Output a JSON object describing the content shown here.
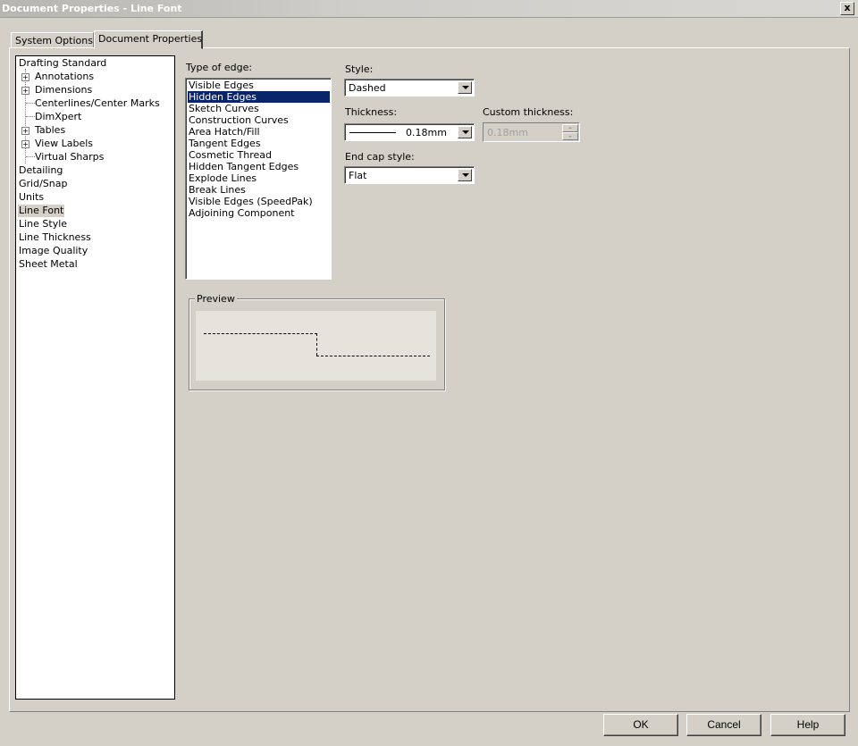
{
  "window": {
    "title": "Document Properties - Line Font",
    "close_label": "x"
  },
  "tabs": [
    {
      "label": "System Options",
      "active": false
    },
    {
      "label": "Document Properties",
      "active": true
    }
  ],
  "tree": {
    "items": [
      {
        "label": "Drafting Standard",
        "expander": ""
      },
      {
        "label": "Annotations",
        "expander": "+"
      },
      {
        "label": "Dimensions",
        "expander": "+"
      },
      {
        "label": "Centerlines/Center Marks",
        "expander": ""
      },
      {
        "label": "DimXpert",
        "expander": ""
      },
      {
        "label": "Tables",
        "expander": "+"
      },
      {
        "label": "View Labels",
        "expander": "+"
      },
      {
        "label": "Virtual Sharps",
        "expander": ""
      },
      {
        "label": "Detailing",
        "expander": ""
      },
      {
        "label": "Grid/Snap",
        "expander": ""
      },
      {
        "label": "Units",
        "expander": ""
      },
      {
        "label": "Line Font",
        "expander": "",
        "selected": true
      },
      {
        "label": "Line Style",
        "expander": ""
      },
      {
        "label": "Line Thickness",
        "expander": ""
      },
      {
        "label": "Image Quality",
        "expander": ""
      },
      {
        "label": "Sheet Metal",
        "expander": ""
      }
    ]
  },
  "edge_type": {
    "label": "Type of edge:",
    "selected": "Hidden Edges",
    "items": [
      "Visible Edges",
      "Hidden Edges",
      "Sketch Curves",
      "Construction Curves",
      "Area Hatch/Fill",
      "Tangent Edges",
      "Cosmetic Thread",
      "Hidden Tangent Edges",
      "Explode Lines",
      "Break Lines",
      "Visible Edges (SpeedPak)",
      "Adjoining Component"
    ]
  },
  "style": {
    "label": "Style:",
    "value": "Dashed"
  },
  "thickness": {
    "label": "Thickness:",
    "value": "0.18mm"
  },
  "custom_thickness": {
    "label": "Custom thickness:",
    "value": "0.18mm"
  },
  "end_cap": {
    "label": "End cap style:",
    "value": "Flat"
  },
  "preview": {
    "label": "Preview"
  },
  "buttons": {
    "ok": "OK",
    "cancel": "Cancel",
    "help": "Help"
  },
  "colors": {
    "selection": "#0a246a",
    "dialog_bg": "#d4d0c8",
    "preview_bg": "#e5e3dc"
  },
  "icons": {
    "expander": "plus-box-icon",
    "dropdown": "chevron-down-icon",
    "close": "close-icon",
    "spinner_up": "arrow-up-icon",
    "spinner_down": "arrow-down-icon"
  }
}
